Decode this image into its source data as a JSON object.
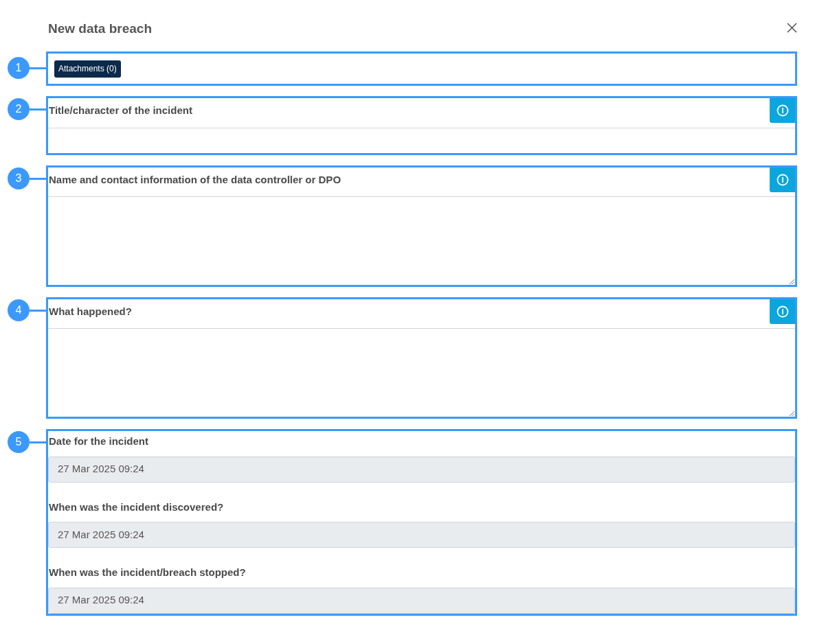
{
  "dialog": {
    "title": "New data breach"
  },
  "sections": [
    {
      "kind": "attachments",
      "callout": "1",
      "button": "Attachments (0)"
    },
    {
      "kind": "input",
      "callout": "2",
      "label": "Title/character of the incident",
      "info": true
    },
    {
      "kind": "textarea",
      "callout": "3",
      "label": "Name and contact information of the data controller or DPO",
      "info": true
    },
    {
      "kind": "textarea",
      "callout": "4",
      "label": "What happened?",
      "info": true
    },
    {
      "kind": "dates",
      "callout": "5",
      "fields": [
        {
          "label": "Date for the incident",
          "value": "27 Mar 2025 09:24"
        },
        {
          "label": "When was the incident discovered?",
          "value": "27 Mar 2025 09:24"
        },
        {
          "label": "When was the incident/breach stopped?",
          "value": "27 Mar 2025 09:24"
        }
      ]
    }
  ]
}
